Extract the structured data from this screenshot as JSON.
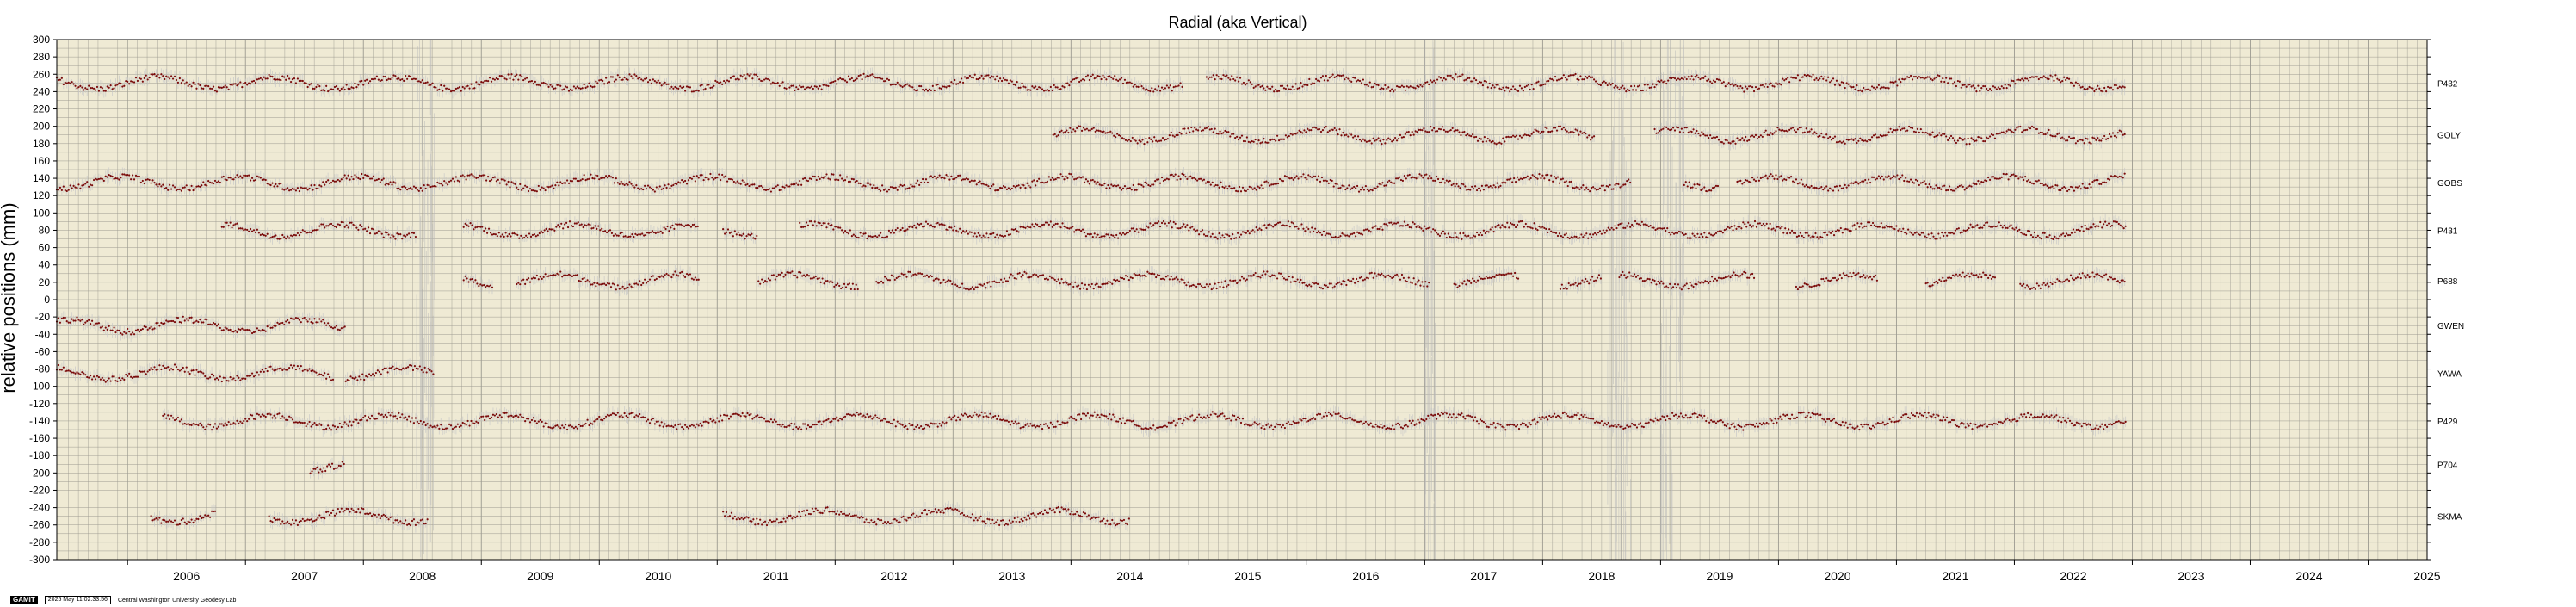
{
  "chart_data": {
    "type": "scatter",
    "title": "Radial (aka Vertical)",
    "ylabel": "relative positions (mm)",
    "xlabel": "",
    "xlim": [
      2005.4,
      2025.5
    ],
    "ylim": [
      -300,
      300
    ],
    "y_ticks": [
      "300",
      "280",
      "260",
      "240",
      "220",
      "200",
      "180",
      "160",
      "140",
      "120",
      "100",
      "80",
      "60",
      "40",
      "20",
      "0",
      "-20",
      "-40",
      "-60",
      "-80",
      "-100",
      "-120",
      "-140",
      "-160",
      "-180",
      "-200",
      "-220",
      "-240",
      "-260",
      "-280",
      "-300"
    ],
    "x_ticks": [
      "2006",
      "2007",
      "2008",
      "2009",
      "2010",
      "2011",
      "2012",
      "2013",
      "2014",
      "2015",
      "2016",
      "2017",
      "2018",
      "2019",
      "2020",
      "2021",
      "2022",
      "2023",
      "2024",
      "2025"
    ],
    "grid": true,
    "background_color": "#efead4",
    "point_color": "#7a0b0b",
    "error_color": "#c8c8c8",
    "series": [
      {
        "name": "P432",
        "offset": 250,
        "segments": [
          [
            2005.4,
            2014.95
          ],
          [
            2015.15,
            2022.95
          ]
        ]
      },
      {
        "name": "GOLY",
        "offset": 190,
        "segments": [
          [
            2013.85,
            2018.45
          ],
          [
            2018.95,
            2022.95
          ]
        ]
      },
      {
        "name": "GOBS",
        "offset": 135,
        "segments": [
          [
            2005.4,
            2018.75
          ],
          [
            2019.2,
            2019.5
          ],
          [
            2019.65,
            2022.95
          ]
        ]
      },
      {
        "name": "P431",
        "offset": 80,
        "segments": [
          [
            2006.8,
            2008.45
          ],
          [
            2008.85,
            2010.85
          ],
          [
            2011.05,
            2011.35
          ],
          [
            2011.7,
            2022.95
          ]
        ]
      },
      {
        "name": "P688",
        "offset": 22,
        "segments": [
          [
            2008.85,
            2009.1
          ],
          [
            2009.3,
            2010.85
          ],
          [
            2011.35,
            2012.2
          ],
          [
            2012.35,
            2013.25
          ],
          [
            2013.25,
            2017.05
          ],
          [
            2017.25,
            2017.8
          ],
          [
            2018.15,
            2018.5
          ],
          [
            2018.65,
            2019.8
          ],
          [
            2020.15,
            2020.85
          ],
          [
            2021.25,
            2021.85
          ],
          [
            2022.05,
            2022.95
          ]
        ]
      },
      {
        "name": "GWEN",
        "offset": -30,
        "segments": [
          [
            2005.4,
            2007.85
          ]
        ]
      },
      {
        "name": "YAWA",
        "offset": -85,
        "segments": [
          [
            2005.4,
            2007.75
          ],
          [
            2007.85,
            2008.6
          ]
        ]
      },
      {
        "name": "P429",
        "offset": -140,
        "segments": [
          [
            2006.3,
            2022.95
          ]
        ]
      },
      {
        "name": "P704",
        "offset": -190,
        "segments": [
          [
            2007.55,
            2007.85
          ]
        ]
      },
      {
        "name": "SKMA",
        "offset": -250,
        "segments": [
          [
            2006.2,
            2006.75
          ],
          [
            2007.2,
            2008.55
          ],
          [
            2011.05,
            2014.5
          ]
        ]
      }
    ]
  },
  "footer": {
    "logo": "GAMIT",
    "timestamp": "2025 May 11 02:33:56",
    "credit": "Central Washington University Geodesy Lab"
  }
}
